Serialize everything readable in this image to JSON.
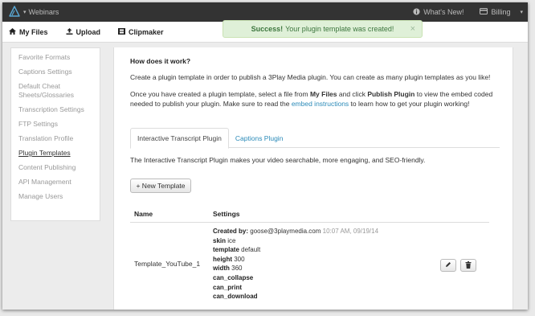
{
  "topbar": {
    "brand_label": "Webinars",
    "whats_new": "What's New!",
    "billing": "Billing"
  },
  "nav": [
    {
      "label": "My Files"
    },
    {
      "label": "Upload"
    },
    {
      "label": "Clipmaker"
    }
  ],
  "toast": {
    "strong": "Success!",
    "message": "Your plugin template was created!",
    "close": "×"
  },
  "sidebar": {
    "items": [
      {
        "label": "Favorite Formats"
      },
      {
        "label": "Captions Settings"
      },
      {
        "label": "Default Cheat Sheets/Glossaries"
      },
      {
        "label": "Transcription Settings"
      },
      {
        "label": "FTP Settings"
      },
      {
        "label": "Translation Profile"
      },
      {
        "label": "Plugin Templates",
        "active": true
      },
      {
        "label": "Content Publishing"
      },
      {
        "label": "API Management"
      },
      {
        "label": "Manage Users"
      }
    ]
  },
  "main": {
    "heading": "How does it work?",
    "para1": "Create a plugin template in order to publish a 3Play Media plugin. You can create as many plugin templates as you like!",
    "para2_a": "Once you have created a plugin template, select a file from ",
    "para2_b": "My Files",
    "para2_c": " and click ",
    "para2_d": "Publish Plugin",
    "para2_e": " to view the embed coded needed to publish your plugin. Make sure to read the ",
    "para2_link": "embed instructions",
    "para2_f": " to learn how to get your plugin working!",
    "tabs": [
      {
        "label": "Interactive Transcript Plugin",
        "active": true
      },
      {
        "label": "Captions Plugin",
        "active": false
      }
    ],
    "tab_description": "The Interactive Transcript Plugin makes your video searchable, more engaging, and SEO-friendly.",
    "new_template_button": "+ New Template",
    "table": {
      "headers": {
        "name": "Name",
        "settings": "Settings"
      },
      "row": {
        "name": "Template_YouTube_1",
        "created_by_label": "Created by:",
        "created_by_value": "goose@3playmedia.com",
        "created_at": "10:07 AM, 09/19/14",
        "skin_label": "skin",
        "skin_value": "ice",
        "template_label": "template",
        "template_value": "default",
        "height_label": "height",
        "height_value": "300",
        "width_label": "width",
        "width_value": "360",
        "flag1": "can_collapse",
        "flag2": "can_print",
        "flag3": "can_download"
      }
    }
  },
  "icons": {
    "logo": "logo-icon",
    "caret": "caret-down-icon",
    "info": "info-circle-icon",
    "billing": "billing-icon",
    "home": "home-icon",
    "upload": "upload-icon",
    "film": "film-icon",
    "edit": "pencil-icon",
    "delete": "trash-icon"
  },
  "colors": {
    "topbar": "#333333",
    "accent_link": "#2a8ab8",
    "toast_bg": "#dff0d8",
    "toast_text": "#3c763d"
  }
}
